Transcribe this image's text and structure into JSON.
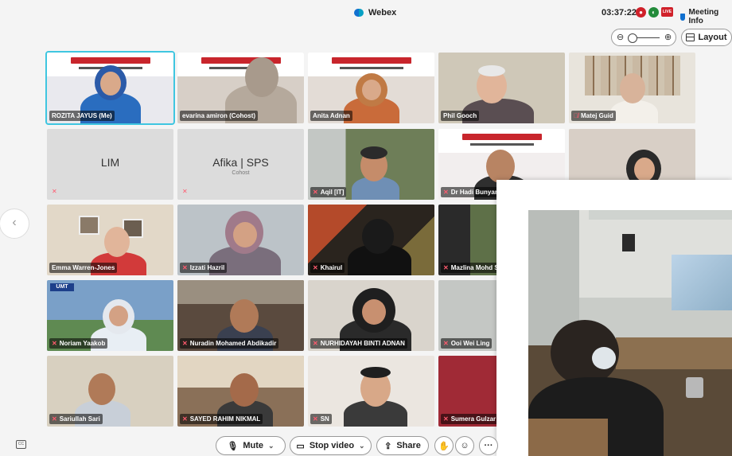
{
  "window": {
    "app_title": "Webex",
    "time": "03:37:22",
    "meeting_info_label": "Meeting Info",
    "rec_icon": "record-icon",
    "live_label": "LIVE"
  },
  "view": {
    "layout_label": "Layout",
    "zoom_minus": "⊖",
    "zoom_plus": "⊕"
  },
  "participants": [
    {
      "name": "ROZITA JAYUS  (Me)",
      "muted": false,
      "active": true
    },
    {
      "name": "evarina amiron  (Cohost)",
      "muted": false
    },
    {
      "name": "Anita Adnan",
      "muted": false
    },
    {
      "name": "Phil Gooch",
      "muted": false
    },
    {
      "name": "Matej Guid",
      "muted": true
    },
    {
      "name": "LIM",
      "muted": true,
      "video_off": true
    },
    {
      "name": "Afika | SPS",
      "role": "Cohost",
      "muted": true,
      "video_off": true
    },
    {
      "name": "Aqil [IT]",
      "muted": true
    },
    {
      "name": "Dr Hadi Bunyamin",
      "muted": true
    },
    {
      "name": "",
      "muted": false
    },
    {
      "name": "Emma Warren-Jones",
      "muted": false
    },
    {
      "name": "Izzati Hazril",
      "muted": true
    },
    {
      "name": "Khairul",
      "muted": true
    },
    {
      "name": "Mazlina Mohd Said",
      "muted": true
    },
    {
      "name": "",
      "muted": false
    },
    {
      "name": "Noriam Yaakob",
      "muted": true
    },
    {
      "name": "Nuradin Mohamed Abdikadir",
      "muted": true
    },
    {
      "name": "NURHIDAYAH BINTI ADNAN",
      "muted": true
    },
    {
      "name": "Ooi Wei Ling",
      "muted": true
    },
    {
      "name": "",
      "muted": false
    },
    {
      "name": "Sariullah Sari",
      "muted": true
    },
    {
      "name": "SAYED RAHIM NIKMAL",
      "muted": true
    },
    {
      "name": "SN",
      "muted": true
    },
    {
      "name": "Sumera Gulzar",
      "muted": true
    },
    {
      "name": "",
      "muted": false
    }
  ],
  "controls": {
    "mute_label": "Mute",
    "stop_video_label": "Stop video",
    "share_label": "Share",
    "more_label": "···"
  },
  "colors": {
    "active_outline": "#3fc6e0",
    "muted_icon": "#ff5a6e",
    "accent": "#1170cf"
  }
}
